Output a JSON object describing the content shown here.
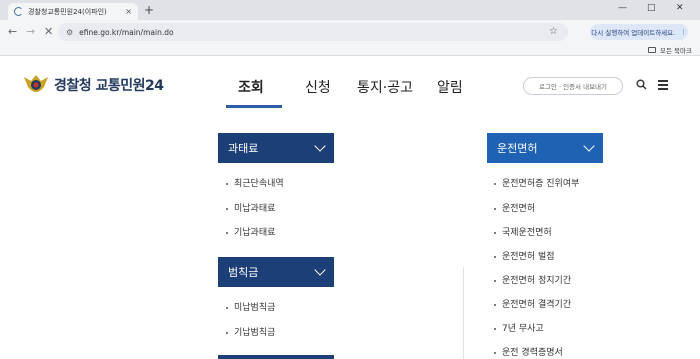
{
  "browser": {
    "tab_title": "경찰청교통민원24(이파인)",
    "tab_close": "×",
    "new_tab": "+",
    "url": "efine.go.kr/main/main.do",
    "update_label": "다시 실행하여 업데이트하세요.",
    "bookmarks_all": "모든 북마크",
    "win_minimize": "—",
    "win_maximize": "□",
    "win_close": "✕"
  },
  "site": {
    "logo_main": "경찰청",
    "logo_sub": "교통민원24",
    "gnb": [
      "조회",
      "신청",
      "통지·공고",
      "알림"
    ],
    "login_label": "로그인 · 인증서 내보내기"
  },
  "left_column": {
    "groups": [
      {
        "title": "과태료",
        "items": [
          "최근단속내역",
          "미납과태료",
          "기납과태료"
        ]
      },
      {
        "title": "범칙금",
        "items": [
          "미납범칙금",
          "기납범칙금"
        ]
      }
    ]
  },
  "right_column": {
    "title": "운전면허",
    "items": [
      "운전면허증 진위여부",
      "운전면허",
      "국제운전면허",
      "운전면허 벌점",
      "운전면허 정지기간",
      "운전면허 결격기간",
      "7년 무사고",
      "운전 경력증명서"
    ]
  },
  "colors": {
    "nav_dark": "#1c3f78",
    "nav_bright": "#1f62b4",
    "underline": "#2e5da8"
  }
}
